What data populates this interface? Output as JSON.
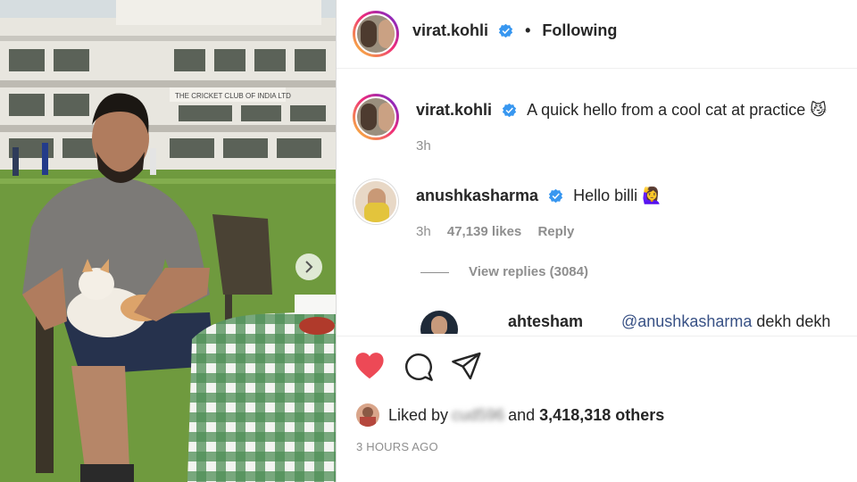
{
  "post": {
    "author": "virat.kohli",
    "follow_state": "Following",
    "separator": "•",
    "caption": "A quick hello from a cool cat at practice 😼",
    "caption_age": "3h",
    "photo_sign": "THE CRICKET CLUB OF INDIA LTD"
  },
  "comments": [
    {
      "username": "anushkasharma",
      "text": "Hello billi 🙋‍♀️",
      "age": "3h",
      "likes": "47,139 likes",
      "reply_label": "Reply",
      "view_replies": "View replies (3084)"
    }
  ],
  "reply_preview": {
    "username": "ahtesham",
    "mention": "@anushkasharma",
    "text": "dekh dekh"
  },
  "likes": {
    "prefix": "Liked by",
    "blurred_user": "cud596",
    "conjunction": "and",
    "count": "3,418,318 others"
  },
  "timestamp": "3 HOURS AGO",
  "icons": {
    "like": "heart-filled-icon",
    "comment": "comment-bubble-icon",
    "share": "paper-plane-icon",
    "verified": "verified-badge-icon",
    "carousel_next": "chevron-right-icon"
  },
  "colors": {
    "like_red": "#ed4956",
    "verified_blue": "#3897f0",
    "mention_blue": "#385185",
    "muted_gray": "#8e8e8e"
  }
}
